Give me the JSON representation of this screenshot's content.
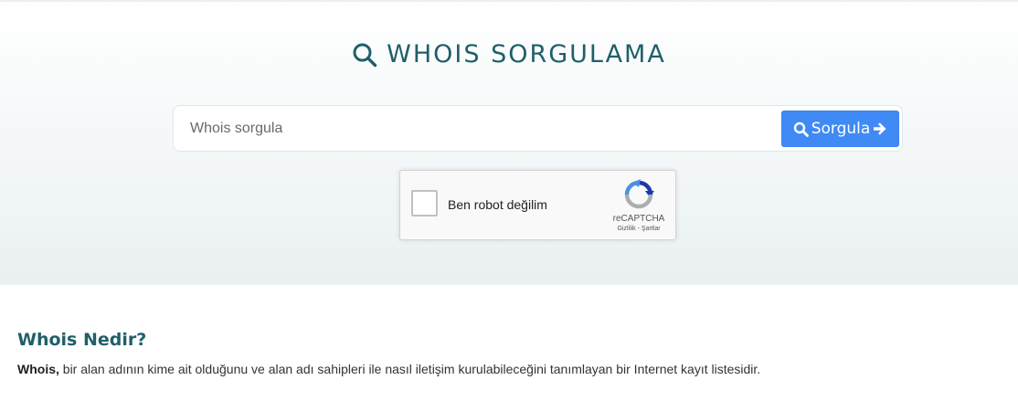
{
  "hero": {
    "title": "WHOIS SORGULAMA"
  },
  "search": {
    "placeholder": "Whois sorgula",
    "button_label": "Sorgula"
  },
  "captcha": {
    "label": "Ben robot değilim",
    "brand": "reCAPTCHA",
    "privacy": "Gizlilik",
    "separator": " - ",
    "terms": "Şartlar"
  },
  "info": {
    "title": "Whois Nedir?",
    "lead": "Whois,",
    "text": " bir alan adının kime ait olduğunu ve alan adı sahipleri ile nasıl iletişim kurulabileceğini tanımlayan bir Internet kayıt listesidir."
  },
  "colors": {
    "accent": "#1f5f69",
    "button": "#3f8af4"
  }
}
